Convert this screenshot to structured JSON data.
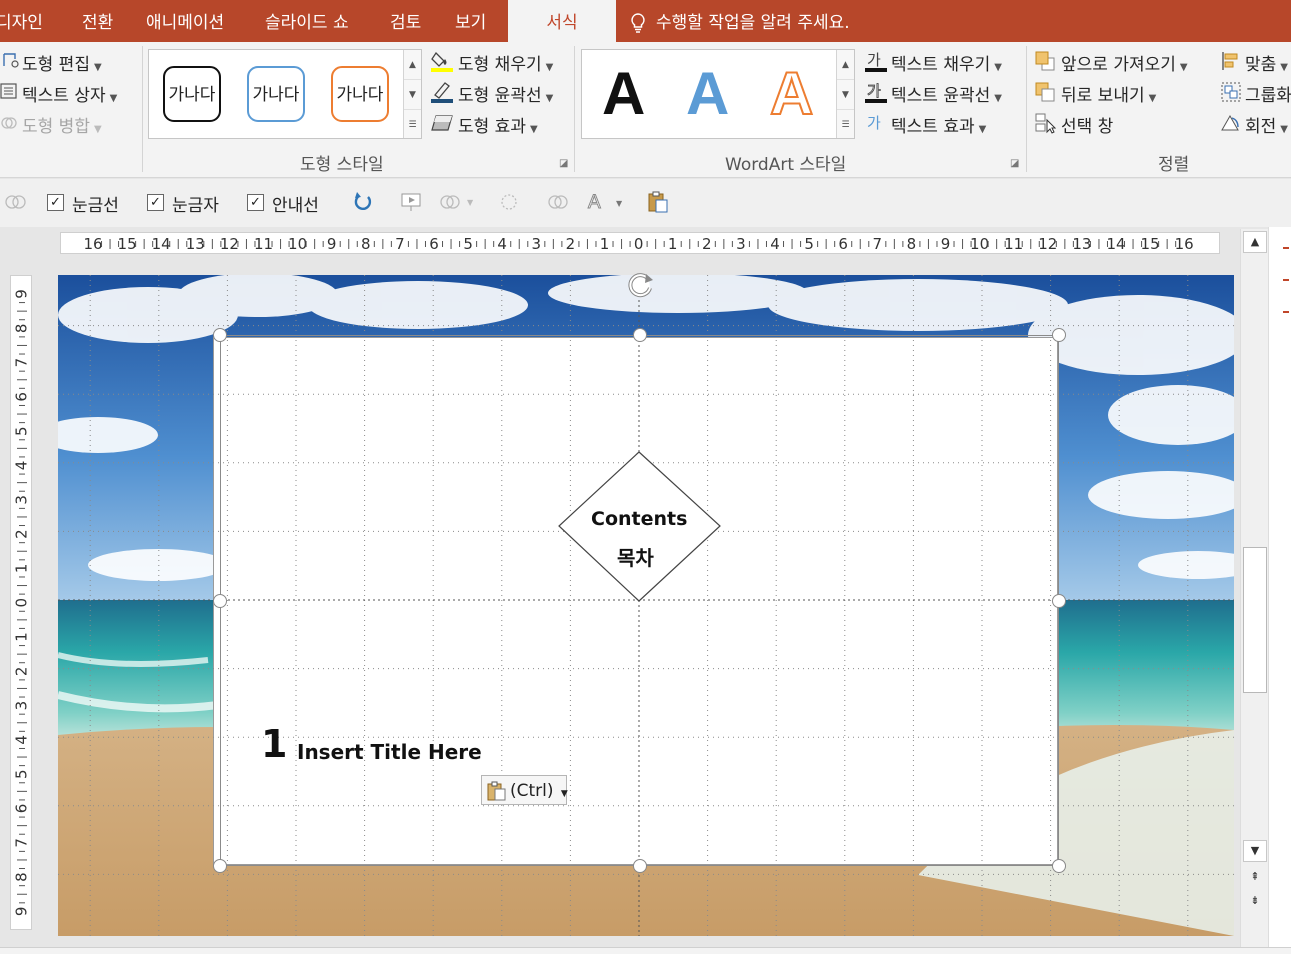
{
  "tabs": [
    "디자인",
    "전환",
    "애니메이션",
    "슬라이드 쇼",
    "검토",
    "보기",
    "서식"
  ],
  "active_tab": "서식",
  "tell_me": "수행할 작업을 알려 주세요.",
  "ribbon": {
    "insert_shapes": {
      "edit_shape": "도형 편집",
      "text_box": "텍스트 상자",
      "merge_shapes": "도형 병합"
    },
    "shape_styles": {
      "label": "도형 스타일",
      "presets": [
        "가나다",
        "가나다",
        "가나다"
      ],
      "fill": "도형 채우기",
      "outline": "도형 윤곽선",
      "effects": "도형 효과"
    },
    "wordart_styles": {
      "label": "WordArt 스타일",
      "presets": [
        "A",
        "A",
        "A"
      ],
      "text_fill": "텍스트 채우기",
      "text_outline": "텍스트 윤곽선",
      "text_effects": "텍스트 효과"
    },
    "arrange": {
      "label": "정렬",
      "bring_forward": "앞으로 가져오기",
      "send_backward": "뒤로 보내기",
      "selection_pane": "선택 창",
      "align": "맞춤",
      "group": "그룹화",
      "rotate": "회전"
    }
  },
  "quick_toolbar": {
    "gridlines": "눈금선",
    "ruler": "눈금자",
    "guides": "안내선",
    "gridlines_checked": true,
    "ruler_checked": true,
    "guides_checked": true
  },
  "hruler_labels": [
    "16",
    "15",
    "14",
    "13",
    "12",
    "11",
    "10",
    "9",
    "8",
    "7",
    "6",
    "5",
    "4",
    "3",
    "2",
    "1",
    "0",
    "1",
    "2",
    "3",
    "4",
    "5",
    "6",
    "7",
    "8",
    "9",
    "10",
    "11",
    "12",
    "13",
    "14",
    "15",
    "16"
  ],
  "vruler_labels": [
    "9",
    "8",
    "7",
    "6",
    "5",
    "4",
    "3",
    "2",
    "1",
    "0",
    "1",
    "2",
    "3",
    "4",
    "5",
    "6",
    "7",
    "8",
    "9"
  ],
  "slide": {
    "diamond_title": "Contents",
    "diamond_subtitle": "목차",
    "item_number": "1",
    "item_title": "Insert Title Here",
    "paste_options": "(Ctrl)"
  },
  "colors": {
    "tab_bar": "#b7472a",
    "ribbon": "#f3f3f3",
    "wordart_blue": "#5b9bd5",
    "wordart_orange": "#ed7d31"
  }
}
